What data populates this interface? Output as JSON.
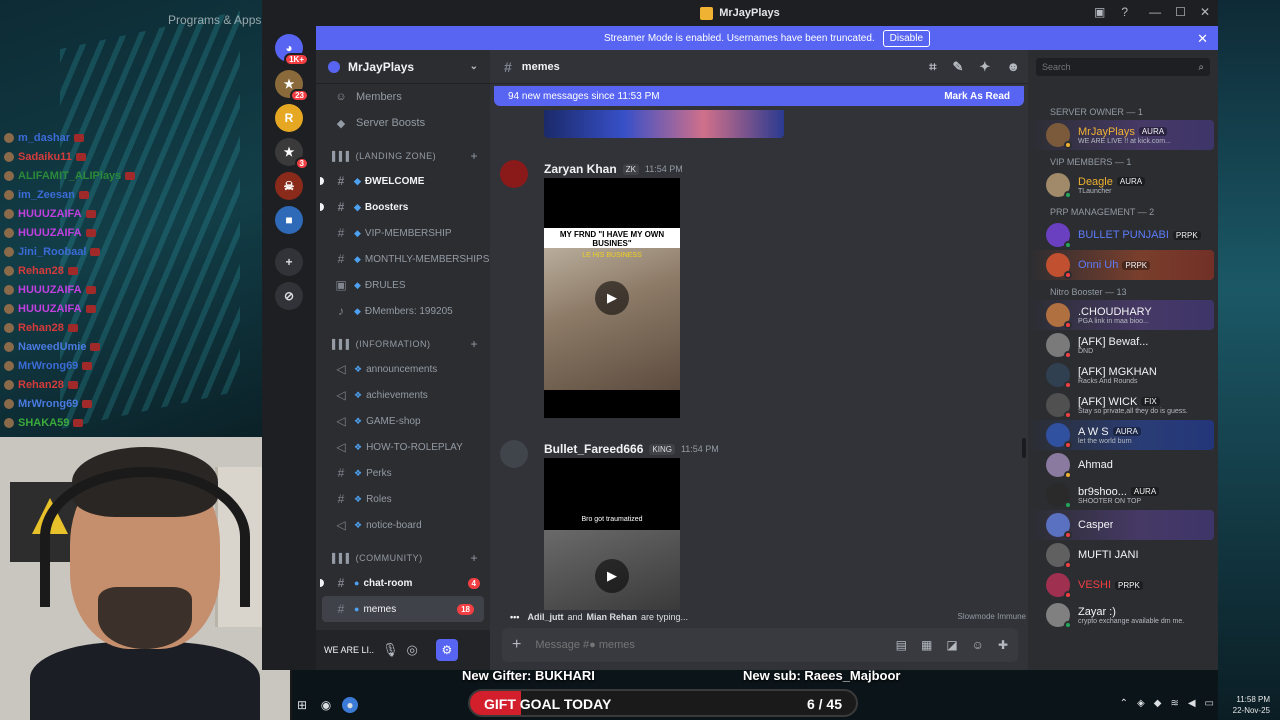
{
  "desktop": {
    "programs_label": "Programs & Apps"
  },
  "stream_chat": [
    {
      "name": "m_dashar",
      "color": "#3b6bd6"
    },
    {
      "name": "Sadaiku11",
      "color": "#d63b3b"
    },
    {
      "name": "ALIFAMIT_ALIPlays",
      "color": "#2a8a3a"
    },
    {
      "name": "im_Zeesan",
      "color": "#3b6bd6"
    },
    {
      "name": "HUUUZAIFA",
      "color": "#c040e0"
    },
    {
      "name": "HUUUZAIFA",
      "color": "#c040e0"
    },
    {
      "name": "Jini_Roobaal",
      "color": "#3b6bd6"
    },
    {
      "name": "Rehan28",
      "color": "#d63b3b"
    },
    {
      "name": "HUUUZAIFA",
      "color": "#c040e0"
    },
    {
      "name": "HUUUZAIFA",
      "color": "#c040e0"
    },
    {
      "name": "Rehan28",
      "color": "#d63b3b"
    },
    {
      "name": "NaweedUmie",
      "color": "#4a7ae0"
    },
    {
      "name": "MrWrong69",
      "color": "#3b6bd6"
    },
    {
      "name": "Rehan28",
      "color": "#d63b3b"
    },
    {
      "name": "MrWrong69",
      "color": "#4a7ae0"
    },
    {
      "name": "SHAKA59",
      "color": "#3aaa3a"
    }
  ],
  "window": {
    "title": "MrJayPlays"
  },
  "banner": {
    "text": "Streamer Mode is enabled. Usernames have been truncated.",
    "button": "Disable"
  },
  "server_rail": [
    {
      "label": "1K+",
      "color": "#5865f2",
      "glyph": "◕"
    },
    {
      "label": "23",
      "color": "#8a6a3a",
      "glyph": "★"
    },
    {
      "label": "",
      "color": "#e6a822",
      "glyph": "R"
    },
    {
      "label": "3",
      "color": "#3a3a3a",
      "glyph": "★"
    },
    {
      "label": "",
      "color": "#8a2a1a",
      "glyph": "☠"
    },
    {
      "label": "",
      "color": "#2f6ab8",
      "glyph": "■"
    }
  ],
  "sidebar": {
    "server_name": "MrJayPlays",
    "nav": [
      {
        "label": "Members",
        "icon": "☺"
      },
      {
        "label": "Server Boosts",
        "icon": "◆"
      }
    ],
    "categories": [
      {
        "label": "▌▌▌ (LANDING ZONE)",
        "channels": [
          {
            "name": "ĐWELCOME",
            "icon": "#",
            "emoji": "◆",
            "unread": true
          },
          {
            "name": "Boosters",
            "icon": "#",
            "emoji": "◆",
            "unread": true
          },
          {
            "name": "VIP-MEMBERSHIP",
            "icon": "#",
            "emoji": "◆"
          },
          {
            "name": "MONTHLY-MEMBERSHIPS",
            "icon": "#",
            "emoji": "◆"
          },
          {
            "name": "ĐRULES",
            "icon": "▣",
            "emoji": "◆"
          },
          {
            "name": "ĐMembers: 199205",
            "icon": "♪",
            "emoji": "◆"
          }
        ]
      },
      {
        "label": "▌▌▌ (INFORMATION)",
        "channels": [
          {
            "name": "announcements",
            "icon": "◁",
            "emoji": "❖"
          },
          {
            "name": "achievements",
            "icon": "◁",
            "emoji": "❖"
          },
          {
            "name": "GAME-shop",
            "icon": "◁",
            "emoji": "❖"
          },
          {
            "name": "HOW-TO-ROLEPLAY",
            "icon": "◁",
            "emoji": "❖"
          },
          {
            "name": "Perks",
            "icon": "#",
            "emoji": "❖"
          },
          {
            "name": "Roles",
            "icon": "#",
            "emoji": "❖"
          },
          {
            "name": "notice-board",
            "icon": "◁",
            "emoji": "❖"
          }
        ]
      },
      {
        "label": "▌▌▌ (COMMUNITY)",
        "channels": [
          {
            "name": "chat-room",
            "icon": "#",
            "emoji": "●",
            "unread": true,
            "mention": "4"
          },
          {
            "name": "memes",
            "icon": "#",
            "emoji": "●",
            "active": true,
            "mention": "18"
          }
        ]
      }
    ],
    "user_panel": {
      "name": "WE ARE LI..."
    }
  },
  "chat": {
    "channel": "memes",
    "new_messages": "94 new messages since 11:53 PM",
    "mark_as_read": "Mark As Read",
    "messages": [
      {
        "author": "Zaryan Khan",
        "tag": "ZK",
        "time": "11:54 PM",
        "caption": "MY FRND \"I HAVE MY OWN BUSINES\"",
        "sub": "LE HIS BUSINESS"
      },
      {
        "author": "Bullet_Fareed666",
        "tag": "KING",
        "time": "11:54 PM",
        "caption": "Bro got traumatized",
        "sub": ""
      }
    ],
    "typing": {
      "user1": "Adil_jutt",
      "and": "and",
      "user2": "Mian Rehan",
      "suffix": "are typing...",
      "slowmode": "Slowmode Immune"
    },
    "composer_placeholder": "Message #● memes"
  },
  "members": {
    "search_placeholder": "Search",
    "groups": [
      {
        "title": "SERVER OWNER — 1",
        "members": [
          {
            "name": "MrJayPlays",
            "badge": "AURA",
            "status": "WE ARE LIVE !! at kick.com...",
            "color": "#f0b232",
            "style": "fancy",
            "av": "#7a5a3a",
            "st": "#f0b232"
          }
        ]
      },
      {
        "title": "VIP MEMBERS — 1",
        "members": [
          {
            "name": "Deagle",
            "badge": "AURA",
            "status": "TLauncher",
            "color": "#f0b232",
            "style": "",
            "av": "#a08a6a",
            "st": "#23a55a"
          }
        ]
      },
      {
        "title": "PRP MANAGEMENT — 2",
        "members": [
          {
            "name": "BULLET PUNJABI",
            "badge": "PRPK",
            "status": "",
            "color": "#5c7cfa",
            "style": "",
            "av": "#6a40c0",
            "st": "#23a55a"
          },
          {
            "name": "Onni Uh",
            "badge": "PRPK",
            "status": "",
            "color": "#5c7cfa",
            "style": "fancy-red",
            "av": "#c05030",
            "st": "#f23f43"
          }
        ]
      },
      {
        "title": "Nitro Booster — 13",
        "members": [
          {
            "name": ".CHOUDHARY",
            "badge": "",
            "status": "PGA link in maa bioo...",
            "color": "#f2f3f5",
            "style": "fancy",
            "av": "#b07040",
            "st": "#f23f43"
          },
          {
            "name": "[AFK] Bewaf...",
            "badge": "",
            "status": "DND",
            "color": "#f2f3f5",
            "style": "",
            "av": "#7a7a7a",
            "st": "#f23f43"
          },
          {
            "name": "[AFK] MGKHAN",
            "badge": "",
            "status": "Racks And Rounds",
            "color": "#f2f3f5",
            "style": "",
            "av": "#304050",
            "st": "#f23f43"
          },
          {
            "name": "[AFK] WICK",
            "badge": "FIX",
            "status": "Stay so private,all they do is guess.",
            "color": "#f2f3f5",
            "style": "",
            "av": "#505050",
            "st": "#f23f43"
          },
          {
            "name": "A W S",
            "badge": "AURA",
            "status": "let the world burn",
            "color": "#f2f3f5",
            "style": "fancy-blue",
            "av": "#3050a0",
            "st": "#f23f43"
          },
          {
            "name": "Ahmad",
            "badge": "",
            "status": "",
            "color": "#f2f3f5",
            "style": "",
            "av": "#8a7aa0",
            "st": "#f0b232"
          },
          {
            "name": "br9shoo...",
            "badge": "AURA",
            "status": "SHOOTER ON TOP",
            "color": "#f2f3f5",
            "style": "",
            "av": "#2a2a2a",
            "st": "#23a55a"
          },
          {
            "name": "Casper",
            "badge": "",
            "status": "",
            "color": "#f2f3f5",
            "style": "fancy",
            "av": "#5a70c0",
            "st": "#f23f43"
          },
          {
            "name": "MUFTI JANI",
            "badge": "",
            "status": "",
            "color": "#f2f3f5",
            "style": "",
            "av": "#606060",
            "st": "#f23f43"
          },
          {
            "name": "VESHI",
            "badge": "PRPK",
            "status": "",
            "color": "#f23f43",
            "style": "",
            "av": "#a03050",
            "st": "#f23f43"
          },
          {
            "name": "Zayar :)",
            "badge": "",
            "status": "crypto exchange available dm me.",
            "color": "#f2f3f5",
            "style": "",
            "av": "#808080",
            "st": "#23a55a"
          }
        ]
      }
    ]
  },
  "stream_overlay": {
    "gifter_label": "New Gifter: BUKHARI",
    "sub_label": "New sub: Raees_Majboor",
    "goal_word1": "GIFT",
    "goal_word2": "GOAL TODAY",
    "goal_count": "6 / 45",
    "goal_progress": 0.133
  },
  "taskbar": {
    "time": "11:58 PM",
    "date": "22-Nov-25"
  }
}
